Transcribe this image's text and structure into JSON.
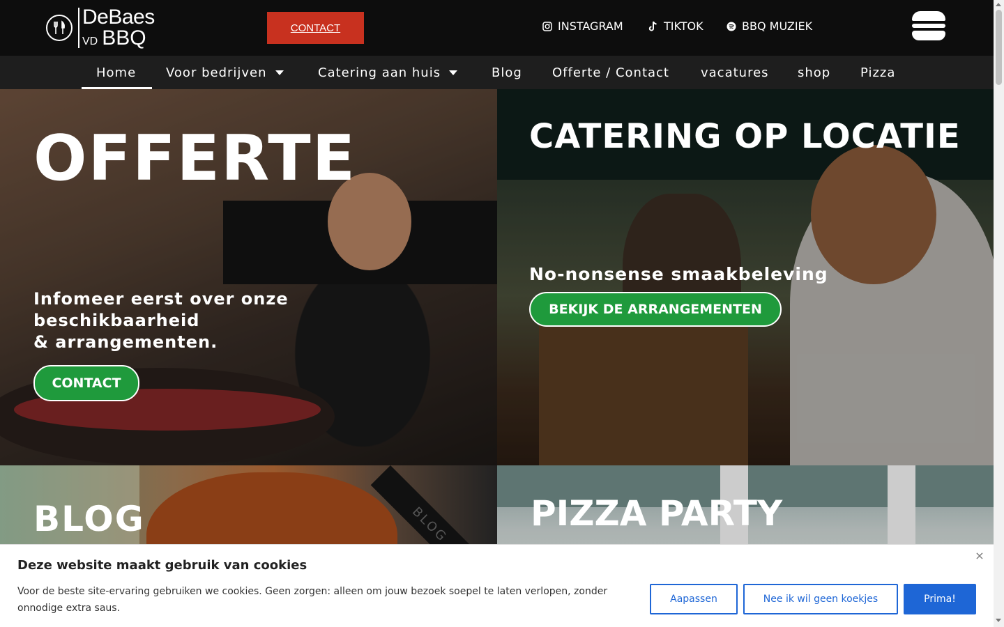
{
  "brand": {
    "line1": "DeBaes",
    "vd": "VD",
    "line2": "BBQ"
  },
  "topbar": {
    "contact_label": "CONTACT",
    "socials": [
      {
        "label": "INSTAGRAM",
        "icon": "instagram-icon"
      },
      {
        "label": "TIKTOK",
        "icon": "tiktok-icon"
      },
      {
        "label": "BBQ MUZIEK",
        "icon": "spotify-icon"
      }
    ],
    "menu_icon": "hamburger-menu-icon"
  },
  "nav": {
    "items": [
      {
        "label": "Home",
        "active": true
      },
      {
        "label": "Voor bedrijven",
        "dropdown": true
      },
      {
        "label": "Catering aan huis",
        "dropdown": true
      },
      {
        "label": "Blog"
      },
      {
        "label": "Offerte / Contact"
      },
      {
        "label": "vacatures"
      },
      {
        "label": "shop"
      },
      {
        "label": "Pizza"
      }
    ]
  },
  "tiles": {
    "offerte": {
      "title": "OFFERTE",
      "sub_lines": [
        "Infomeer eerst over onze",
        "beschikbaarheid",
        "& arrangementen."
      ],
      "button": "CONTACT"
    },
    "catering": {
      "title": "CATERING OP LOCATIE",
      "sub": "No-nonsense smaakbeleving",
      "button": "BEKIJK DE ARRANGEMENTEN"
    },
    "blog": {
      "title": "BLOG",
      "ribbon": "BLOG"
    },
    "pizza": {
      "title": "PIZZA PARTY"
    }
  },
  "cookie": {
    "title": "Deze website maakt gebruik van cookies",
    "text": "Voor de beste site-ervaring gebruiken we cookies. Geen zorgen: alleen om jouw bezoek soepel te laten verlopen, zonder onnodige extra saus.",
    "close": "×",
    "buttons": {
      "customize": "Aapassen",
      "decline": "Nee ik wil geen koekjes",
      "accept": "Prima!"
    }
  },
  "colors": {
    "topbar": "#0d0d0d",
    "nav": "#1e1e1e",
    "contact_red": "#c8311f",
    "green": "#1f9a3c",
    "cookie_blue": "#1e66d6"
  }
}
